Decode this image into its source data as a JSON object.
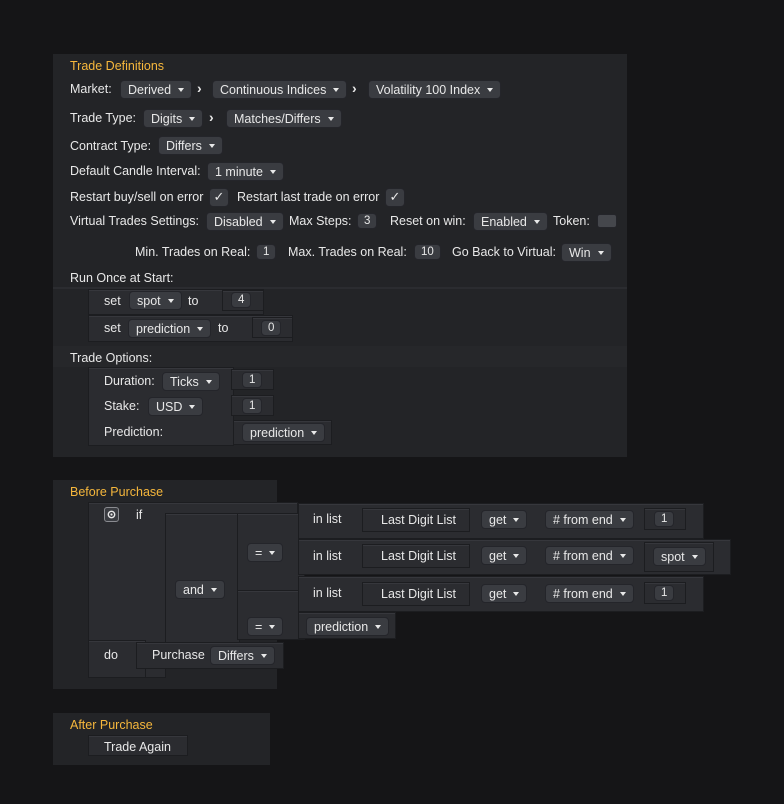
{
  "trade_definitions": {
    "header": "Trade Definitions",
    "market_label": "Market:",
    "market": "Derived",
    "submarket": "Continuous Indices",
    "symbol": "Volatility 100 Index",
    "trade_type_label": "Trade Type:",
    "trade_type_category": "Digits",
    "trade_type": "Matches/Differs",
    "contract_type_label": "Contract Type:",
    "contract_type": "Differs",
    "candle_interval_label": "Default Candle Interval:",
    "candle_interval": "1 minute",
    "restart_on_error_label": "Restart buy/sell on error",
    "restart_on_error_checked": true,
    "restart_last_trade_label": "Restart last trade on error",
    "restart_last_trade_checked": true,
    "virtual_label": "Virtual Trades Settings:",
    "virtual_value": "Disabled",
    "max_steps_label": "Max Steps:",
    "max_steps": "3",
    "reset_on_win_label": "Reset on win:",
    "reset_on_win": "Enabled",
    "token_label": "Token:",
    "min_trades_label": "Min. Trades on Real:",
    "min_trades": "1",
    "max_trades_label": "Max. Trades on Real:",
    "max_trades": "10",
    "go_back_label": "Go Back to Virtual:",
    "go_back_value": "Win",
    "run_once_label": "Run Once at Start:",
    "set_label": "set",
    "to_label": "to",
    "var_spot": "spot",
    "spot_value": "4",
    "var_prediction": "prediction",
    "prediction_value": "0",
    "trade_options_label": "Trade Options:",
    "duration_label": "Duration:",
    "duration_unit": "Ticks",
    "duration_value": "1",
    "stake_label": "Stake:",
    "currency": "USD",
    "stake_value": "1",
    "prediction_label": "Prediction:",
    "prediction_var": "prediction"
  },
  "before_purchase": {
    "header": "Before Purchase",
    "if_label": "if",
    "and_label": "and",
    "eq_label": "=",
    "in_list_label": "in list",
    "list_name": "Last Digit List",
    "get_label": "get",
    "from_end_label": "# from end",
    "row1_value": "1",
    "row2_var": "spot",
    "row3_value": "1",
    "compare_var": "prediction",
    "do_label": "do",
    "purchase_label": "Purchase",
    "purchase_type": "Differs"
  },
  "after_purchase": {
    "header": "After Purchase",
    "trade_again_label": "Trade Again"
  },
  "colors": {
    "background": "#151517",
    "block_outer": "#232427",
    "block_inner": "#2b2c30",
    "header_accent": "#f6b73c",
    "text": "#e8e8e8"
  }
}
